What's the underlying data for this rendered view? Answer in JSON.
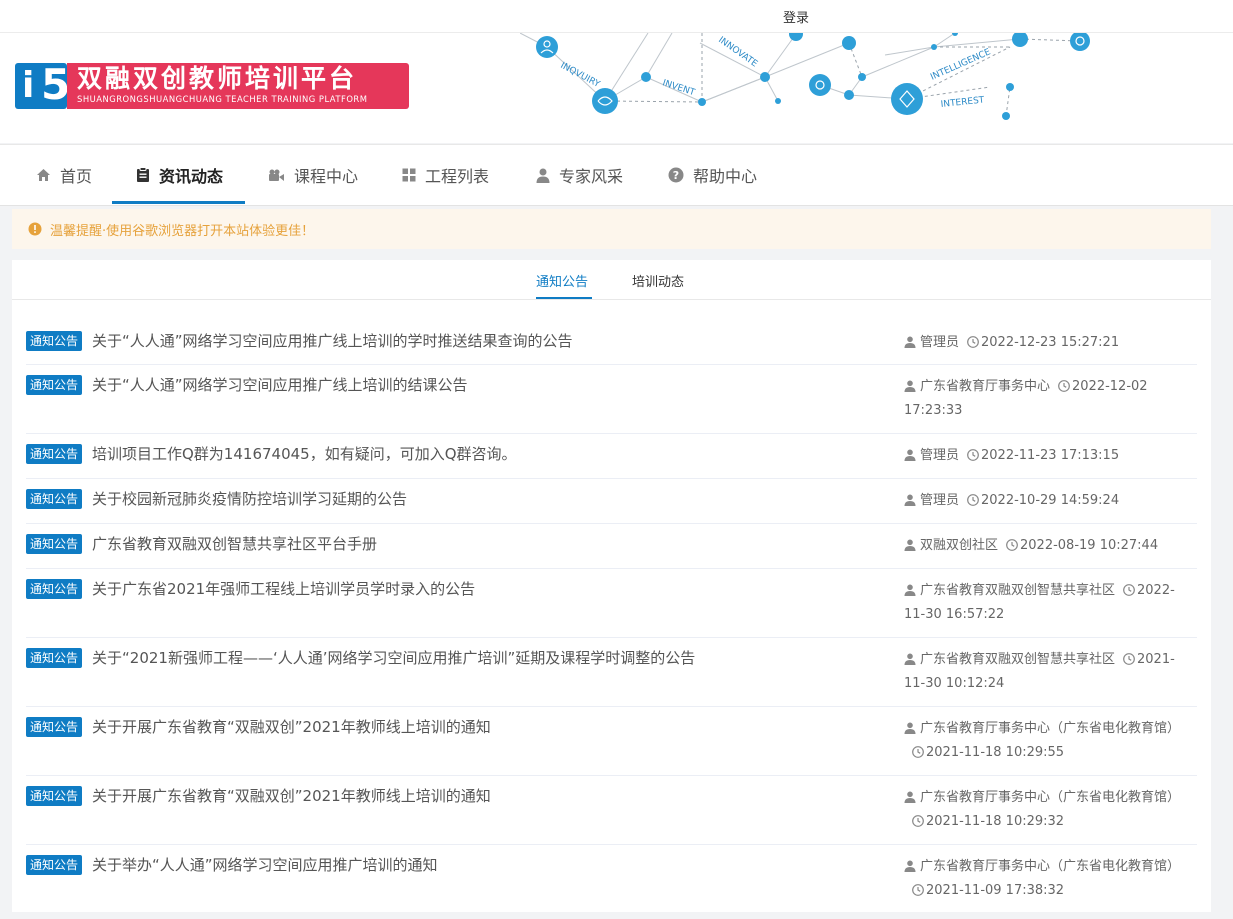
{
  "top": {
    "login": "登录"
  },
  "logo": {
    "mark": "i5",
    "title_cn": "双融双创教师培训平台",
    "title_en": "SHUANGRONGSHUANGCHUANG TEACHER TRAINING PLATFORM"
  },
  "banner_words": [
    "INQVUIRY",
    "INVENT",
    "INNOVATE",
    "INTELLIGENCE",
    "INTEREST"
  ],
  "nav": {
    "items": [
      {
        "label": "首页",
        "icon": "home-icon"
      },
      {
        "label": "资讯动态",
        "icon": "clipboard-icon",
        "active": true
      },
      {
        "label": "课程中心",
        "icon": "video-camera-icon"
      },
      {
        "label": "工程列表",
        "icon": "grid-icon"
      },
      {
        "label": "专家风采",
        "icon": "user-icon"
      },
      {
        "label": "帮助中心",
        "icon": "question-icon"
      }
    ]
  },
  "notice": {
    "text": "温馨提醒·使用谷歌浏览器打开本站体验更佳！"
  },
  "tabs": [
    {
      "label": "通知公告",
      "active": true
    },
    {
      "label": "培训动态"
    }
  ],
  "badge_label": "通知公告",
  "announcements": [
    {
      "title": "关于“人人通”网络学习空间应用推广线上培训的学时推送结果查询的公告",
      "author": "管理员",
      "date": "2022-12-23 15:27:21"
    },
    {
      "title": "关于“人人通”网络学习空间应用推广线上培训的结课公告",
      "author": "广东省教育厅事务中心",
      "date": "2022-12-02 17:23:33"
    },
    {
      "title": "培训项目工作Q群为141674045，如有疑问，可加入Q群咨询。",
      "author": "管理员",
      "date": "2022-11-23 17:13:15"
    },
    {
      "title": "关于校园新冠肺炎疫情防控培训学习延期的公告",
      "author": "管理员",
      "date": "2022-10-29 14:59:24"
    },
    {
      "title": "广东省教育双融双创智慧共享社区平台手册",
      "author": "双融双创社区",
      "date": "2022-08-19 10:27:44"
    },
    {
      "title": "关于广东省2021年强师工程线上培训学员学时录入的公告",
      "author": "广东省教育双融双创智慧共享社区",
      "date": "2022-11-30 16:57:22"
    },
    {
      "title": "关于“2021新强师工程——‘人人通’网络学习空间应用推广培训”延期及课程学时调整的公告",
      "author": "广东省教育双融双创智慧共享社区",
      "date": "2021-11-30 10:12:24"
    },
    {
      "title": "关于开展广东省教育“双融双创”2021年教师线上培训的通知",
      "author": "广东省教育厅事务中心（广东省电化教育馆）",
      "date": "2021-11-18 10:29:55"
    },
    {
      "title": "关于开展广东省教育“双融双创”2021年教师线上培训的通知",
      "author": "广东省教育厅事务中心（广东省电化教育馆）",
      "date": "2021-11-18 10:29:32"
    },
    {
      "title": "关于举办“人人通”网络学习空间应用推广培训的通知",
      "author": "广东省教育厅事务中心（广东省电化教育馆）",
      "date": "2021-11-09 17:38:32"
    }
  ]
}
